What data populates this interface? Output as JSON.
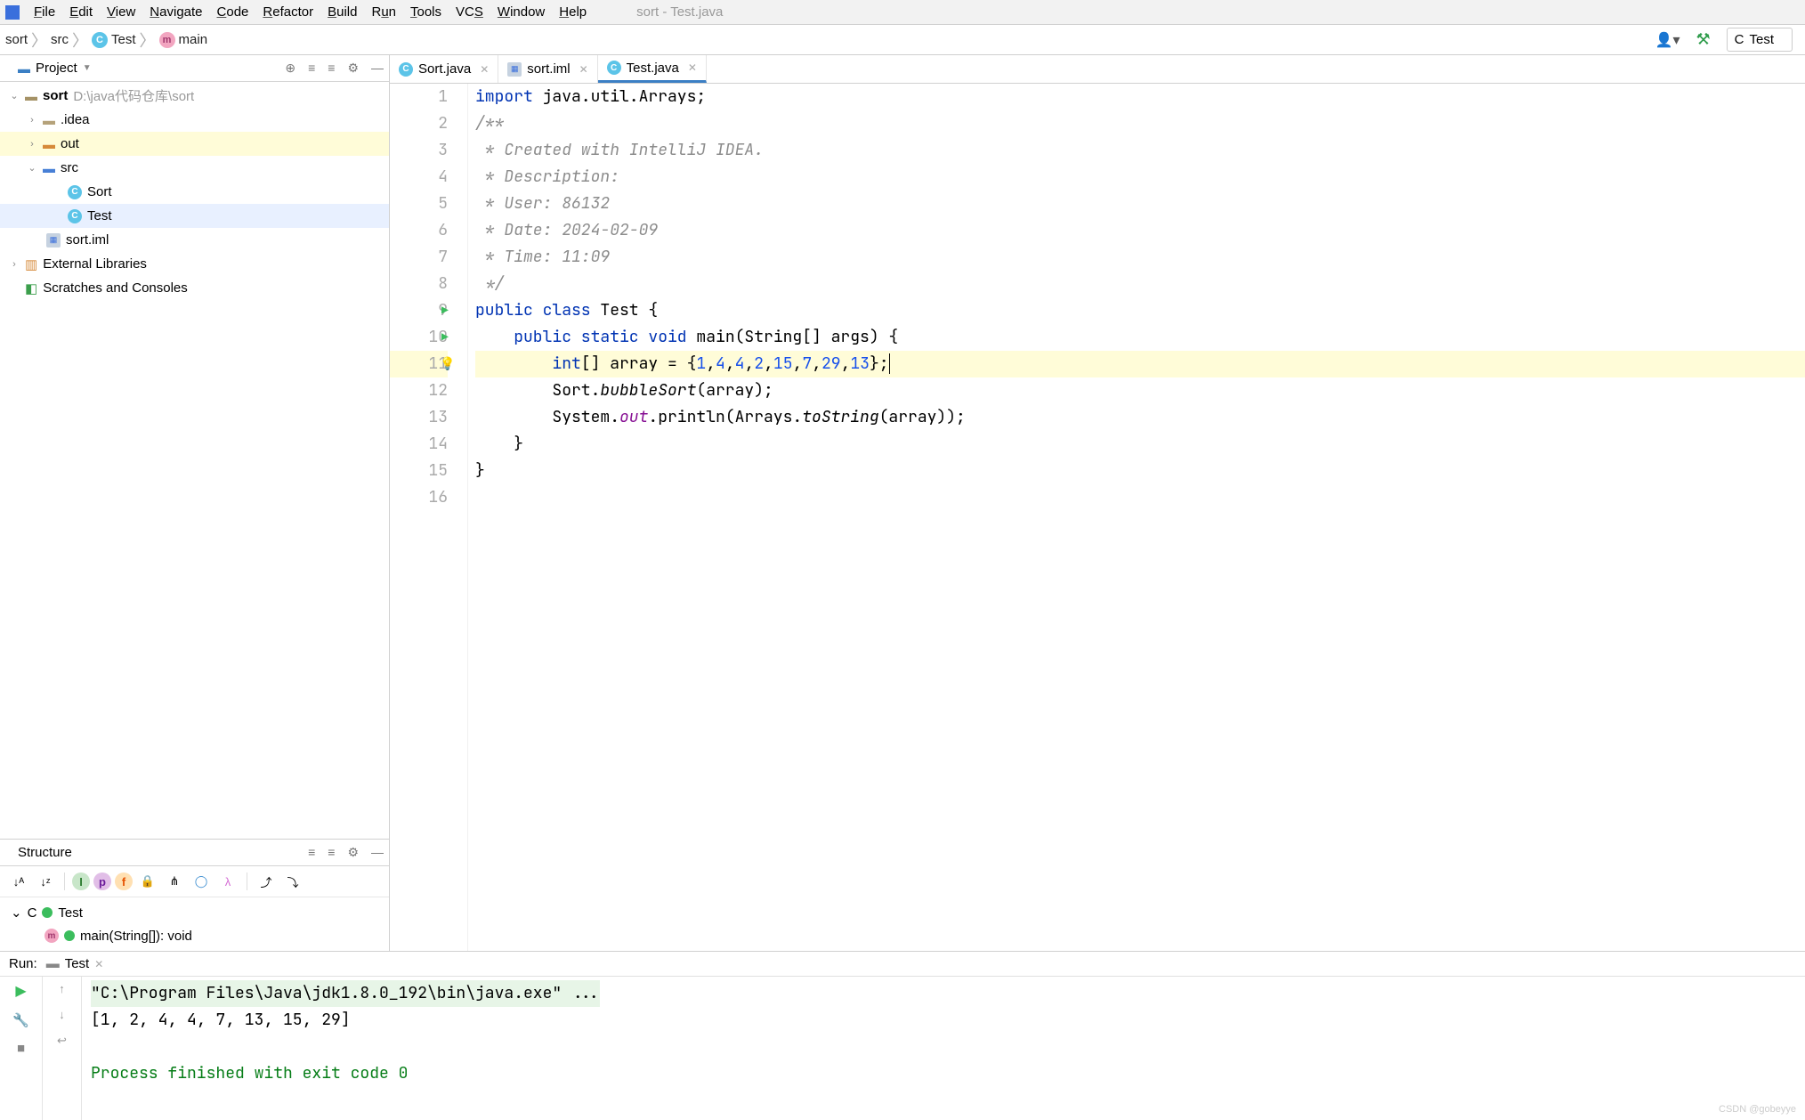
{
  "window": {
    "title": "sort - Test.java"
  },
  "menu": {
    "items": [
      "File",
      "Edit",
      "View",
      "Navigate",
      "Code",
      "Refactor",
      "Build",
      "Run",
      "Tools",
      "VCS",
      "Window",
      "Help"
    ]
  },
  "breadcrumb": {
    "parts": [
      "sort",
      "src",
      "Test",
      "main"
    ]
  },
  "nav_right": {
    "run_config": "Test"
  },
  "project": {
    "header": "Project",
    "root": {
      "name": "sort",
      "path": "D:\\java代码仓库\\sort"
    },
    "idea": ".idea",
    "out": "out",
    "src": "src",
    "classes": [
      "Sort",
      "Test"
    ],
    "iml": "sort.iml",
    "ext_libs": "External Libraries",
    "scratches": "Scratches and Consoles"
  },
  "structure": {
    "header": "Structure",
    "class": "Test",
    "method": "main(String[]): void"
  },
  "tabs": [
    {
      "name": "Sort.java",
      "icon": "class"
    },
    {
      "name": "sort.iml",
      "icon": "iml"
    },
    {
      "name": "Test.java",
      "icon": "class",
      "active": true
    }
  ],
  "code": {
    "lines": [
      {
        "n": 1,
        "tokens": [
          [
            "kw",
            "import"
          ],
          [
            "",
            " java.util.Arrays;"
          ]
        ]
      },
      {
        "n": 2,
        "tokens": [
          [
            "com",
            "/**"
          ]
        ]
      },
      {
        "n": 3,
        "tokens": [
          [
            "com",
            " * Created with IntelliJ IDEA."
          ]
        ]
      },
      {
        "n": 4,
        "tokens": [
          [
            "com",
            " * Description:"
          ]
        ]
      },
      {
        "n": 5,
        "tokens": [
          [
            "com",
            " * User: 86132"
          ]
        ]
      },
      {
        "n": 6,
        "tokens": [
          [
            "com",
            " * Date: 2024-02-09"
          ]
        ]
      },
      {
        "n": 7,
        "tokens": [
          [
            "com",
            " * Time: 11:09"
          ]
        ]
      },
      {
        "n": 8,
        "tokens": [
          [
            "com",
            " */"
          ]
        ]
      },
      {
        "n": 9,
        "tokens": [
          [
            "kw",
            "public class"
          ],
          [
            "",
            " Test {"
          ]
        ],
        "run": true
      },
      {
        "n": 10,
        "tokens": [
          [
            "",
            "    "
          ],
          [
            "kw",
            "public static void"
          ],
          [
            "",
            " "
          ],
          [
            "cls",
            "main"
          ],
          [
            "",
            "(String[] args) {"
          ]
        ],
        "run": true
      },
      {
        "n": 11,
        "tokens": [
          [
            "",
            "        "
          ],
          [
            "kw",
            "int"
          ],
          [
            "",
            "[] array = {"
          ],
          [
            "num",
            "1"
          ],
          [
            "",
            ","
          ],
          [
            "num",
            "4"
          ],
          [
            "",
            ","
          ],
          [
            "num",
            "4"
          ],
          [
            "",
            ","
          ],
          [
            "num",
            "2"
          ],
          [
            "",
            ","
          ],
          [
            "num",
            "15"
          ],
          [
            "",
            ","
          ],
          [
            "num",
            "7"
          ],
          [
            "",
            ","
          ],
          [
            "num",
            "29"
          ],
          [
            "",
            ","
          ],
          [
            "num",
            "13"
          ],
          [
            "",
            "};"
          ]
        ],
        "hl": true,
        "bulb": true,
        "cursor": true
      },
      {
        "n": 12,
        "tokens": [
          [
            "",
            "        Sort."
          ],
          [
            "fn-it",
            "bubbleSort"
          ],
          [
            "",
            "(array);"
          ]
        ]
      },
      {
        "n": 13,
        "tokens": [
          [
            "",
            "        System."
          ],
          [
            "static-it",
            "out"
          ],
          [
            "",
            ".println(Arrays."
          ],
          [
            "fn-it",
            "toString"
          ],
          [
            "",
            "(array));"
          ]
        ]
      },
      {
        "n": 14,
        "tokens": [
          [
            "",
            "    }"
          ]
        ]
      },
      {
        "n": 15,
        "tokens": [
          [
            "",
            "}"
          ]
        ]
      },
      {
        "n": 16,
        "tokens": [
          [
            "",
            ""
          ]
        ]
      }
    ]
  },
  "run": {
    "title": "Run:",
    "tab": "Test",
    "cmd": "\"C:\\Program Files\\Java\\jdk1.8.0_192\\bin\\java.exe\" ...",
    "output": "[1, 2, 4, 4, 7, 13, 15, 29]",
    "exit": "Process finished with exit code 0"
  },
  "watermark": "CSDN @gobeyye"
}
